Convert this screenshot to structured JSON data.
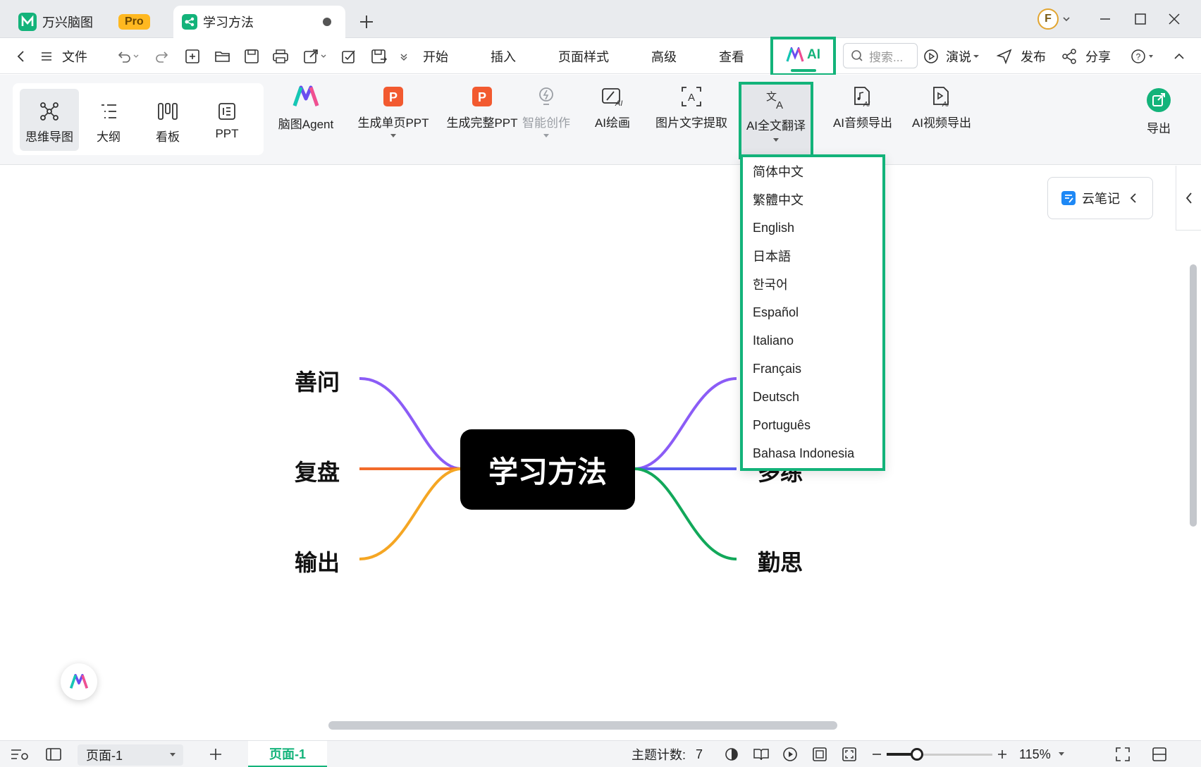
{
  "colors": {
    "accent": "#13b37a",
    "branch_purple": "#8b5cf6",
    "branch_orange": "#f26b2a",
    "branch_yellow": "#f5a623",
    "branch_blue": "#5b5cf0",
    "branch_green": "#12a85a",
    "pro_badge": "#ffb820",
    "root_bg": "#000000"
  },
  "titlebar": {
    "app_name": "万兴脑图",
    "pro_badge": "Pro",
    "doc_tab": "学习方法",
    "avatar_letter": "F"
  },
  "menubar": {
    "file": "文件",
    "start": "开始",
    "insert": "插入",
    "page_style": "页面样式",
    "advanced": "高级",
    "view": "查看",
    "ai": "AI",
    "search_placeholder": "搜索...",
    "present": "演说",
    "publish": "发布",
    "share": "分享"
  },
  "ribbon": {
    "views": [
      "思维导图",
      "大纲",
      "看板",
      "PPT"
    ],
    "agent": "脑图Agent",
    "single_ppt": "生成单页PPT",
    "full_ppt": "生成完整PPT",
    "smart_create": "智能创作",
    "ai_draw": "AI绘画",
    "ocr": "图片文字提取",
    "translate": "AI全文翻译",
    "audio_export": "AI音频导出",
    "video_export": "AI视频导出",
    "export": "导出"
  },
  "translate_menu": {
    "languages": [
      "简体中文",
      "繁體中文",
      "English",
      "日本語",
      "한국어",
      "Español",
      "Italiano",
      "Français",
      "Deutsch",
      "Português",
      "Bahasa Indonesia"
    ]
  },
  "notes_panel": {
    "label": "云笔记"
  },
  "mindmap": {
    "root": "学习方法",
    "left": [
      "善问",
      "复盘",
      "输出"
    ],
    "right_hidden_top": "",
    "right": [
      "多练",
      "勤思"
    ]
  },
  "statusbar": {
    "page_select": "页面-1",
    "page_tab": "页面-1",
    "topic_count_label": "主题计数:",
    "topic_count": "7",
    "zoom": "115%"
  }
}
